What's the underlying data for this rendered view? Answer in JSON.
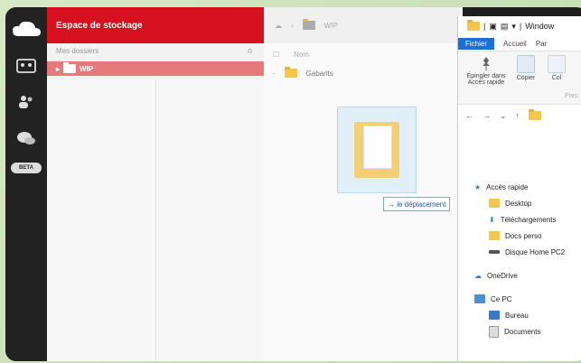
{
  "left_panel": {
    "header": "Espace de stockage",
    "sub_label": "Mes dossiers",
    "sub_mark": "≎",
    "selected_folder": "WIP",
    "badge": "BETA"
  },
  "main": {
    "breadcrumb_folder": "WIP",
    "column_header": "Nom",
    "item_name": "Gabarits"
  },
  "drag": {
    "tooltip": "→ le déplacement"
  },
  "explorer": {
    "title": "Window",
    "tabs": [
      "Fichier",
      "Accueil",
      "Par"
    ],
    "ribbon": {
      "pin_label": "Épingler dans Accès rapide",
      "copy_label": "Copier",
      "paste_label": "Col",
      "section": "Pres"
    },
    "nav": [
      "←",
      "→",
      "⌄",
      "↑"
    ],
    "tree": [
      {
        "label": "Accès rapide",
        "icon": "star-icon",
        "color": "#2b78d0"
      },
      {
        "label": "Desktop",
        "icon": "folder-icon",
        "color": "#f4c64f"
      },
      {
        "label": "Téléchargements",
        "icon": "download-icon",
        "color": "#2b78d0"
      },
      {
        "label": "Docs perso",
        "icon": "folder-icon",
        "color": "#f4c64f"
      },
      {
        "label": "Disque Home PC2",
        "icon": "drive-icon",
        "color": "#555555"
      },
      {
        "label": "OneDrive",
        "icon": "cloud-icon",
        "color": "#2b78d0"
      },
      {
        "label": "Ce PC",
        "icon": "pc-icon",
        "color": "#4a90d9"
      },
      {
        "label": "Bureau",
        "icon": "desktop-icon",
        "color": "#3a78c8"
      },
      {
        "label": "Documents",
        "icon": "document-icon",
        "color": "#999999"
      }
    ]
  },
  "colors": {
    "accent_red": "#d6101e",
    "selected_row": "#e67a7a",
    "file_tab_blue": "#1a6fd8"
  }
}
